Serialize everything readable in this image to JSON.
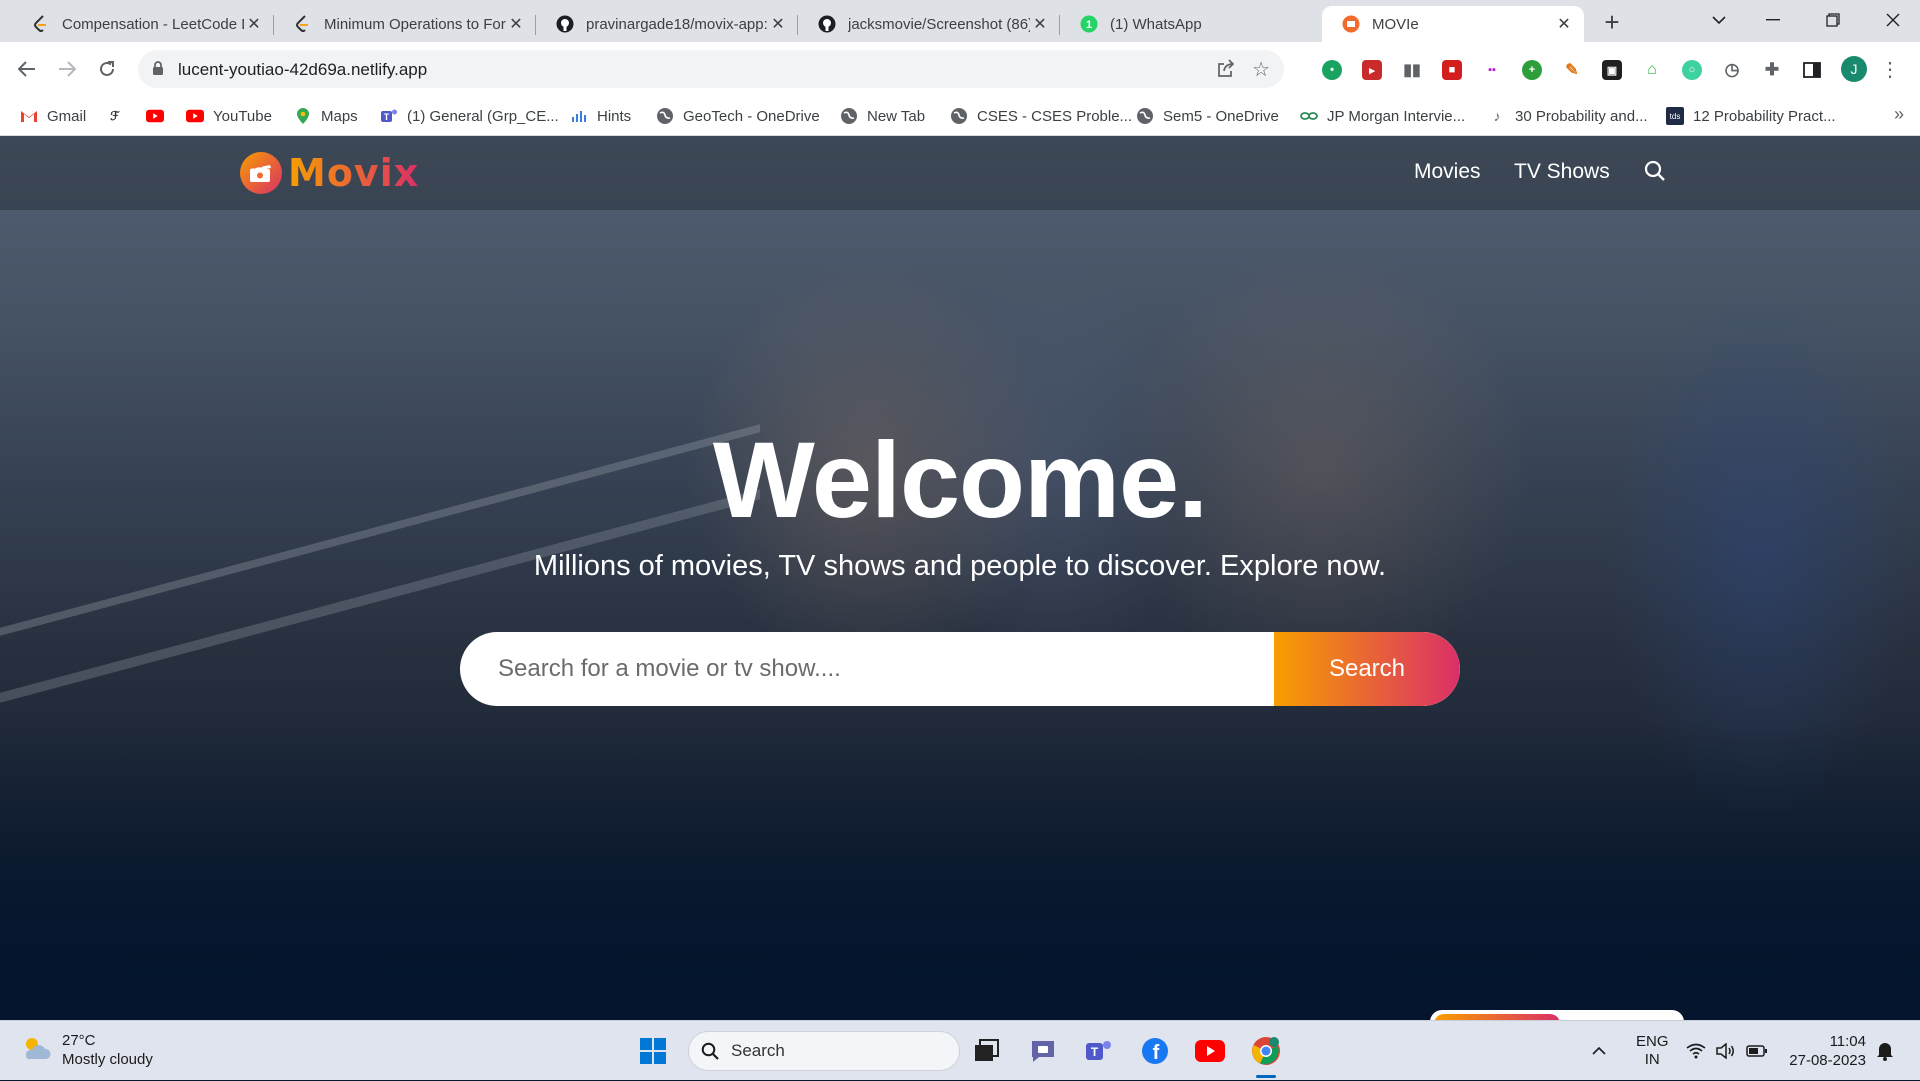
{
  "browser": {
    "tabs": [
      {
        "title": "Compensation - LeetCode D",
        "icon": "leetcode-icon"
      },
      {
        "title": "Minimum Operations to For",
        "icon": "leetcode-icon"
      },
      {
        "title": "pravinargade18/movix-app:",
        "icon": "github-icon"
      },
      {
        "title": "jacksmovie/Screenshot (86)",
        "icon": "github-icon"
      },
      {
        "title": "(1) WhatsApp",
        "icon": "whatsapp-icon"
      },
      {
        "title": "MOVIe",
        "icon": "movix-icon",
        "active": true
      }
    ],
    "url": "lucent-youtiao-42d69a.netlify.app",
    "profile_initial": "J",
    "bookmarks": [
      {
        "label": "Gmail",
        "icon": "gmail-icon"
      },
      {
        "label": "",
        "icon": "bookmark-icon"
      },
      {
        "label": "",
        "icon": "youtube-icon"
      },
      {
        "label": "YouTube",
        "icon": "youtube-icon"
      },
      {
        "label": "Maps",
        "icon": "maps-icon"
      },
      {
        "label": "(1) General (Grp_CE...",
        "icon": "teams-icon"
      },
      {
        "label": "Hints",
        "icon": "hints-icon"
      },
      {
        "label": "GeoTech - OneDrive",
        "icon": "globe-icon"
      },
      {
        "label": "New Tab",
        "icon": "globe-icon"
      },
      {
        "label": "CSES - CSES Proble...",
        "icon": "globe-icon"
      },
      {
        "label": "Sem5 - OneDrive",
        "icon": "globe-icon"
      },
      {
        "label": "JP Morgan Intervie...",
        "icon": "link-icon"
      },
      {
        "label": "30 Probability and...",
        "icon": "music-icon"
      },
      {
        "label": "12 Probability Pract...",
        "icon": "tds-icon"
      }
    ],
    "bookmarks_more": "»",
    "tds_badge": "tds"
  },
  "site": {
    "logo_text": "Movix",
    "nav": {
      "movies": "Movies",
      "tv_shows": "TV Shows"
    },
    "hero_title": "Welcome.",
    "hero_subtitle": "Millions of movies, TV shows and people to discover. Explore now.",
    "search_placeholder": "Search for a movie or tv show....",
    "search_button": "Search",
    "colors": {
      "accent_start": "#f89e00",
      "accent_end": "#da2f68",
      "bg": "#04152d"
    }
  },
  "taskbar": {
    "weather_temp": "27°C",
    "weather_desc": "Mostly cloudy",
    "search_label": "Search",
    "lang_primary": "ENG",
    "lang_secondary": "IN",
    "time": "11:04",
    "date": "27-08-2023"
  }
}
